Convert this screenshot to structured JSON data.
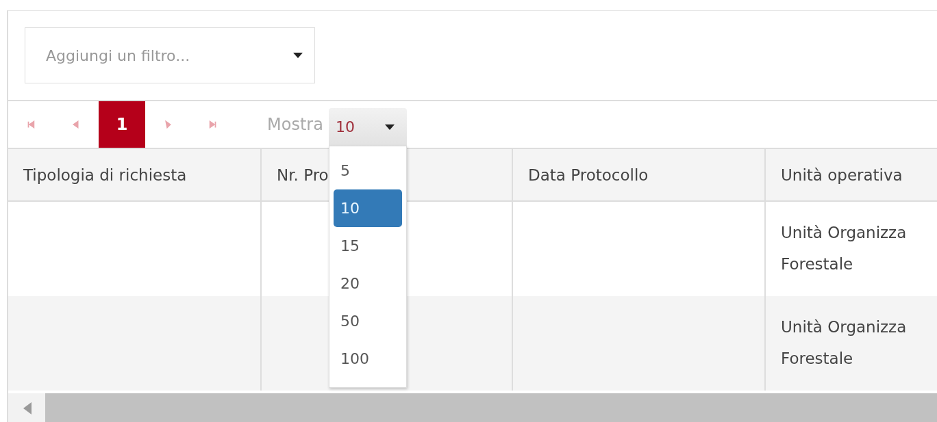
{
  "filter": {
    "placeholder": "Aggiungi un filtro..."
  },
  "pager": {
    "buttons": [
      {
        "kind": "first",
        "disabled": true
      },
      {
        "kind": "prev",
        "disabled": true
      },
      {
        "kind": "page",
        "label": "1",
        "selected": true
      },
      {
        "kind": "next",
        "disabled": true
      },
      {
        "kind": "last",
        "disabled": true
      }
    ],
    "show_label": "Mostra",
    "page_size": "10"
  },
  "page_size_options": [
    {
      "label": "5",
      "selected": false
    },
    {
      "label": "10",
      "selected": true
    },
    {
      "label": "15",
      "selected": false
    },
    {
      "label": "20",
      "selected": false
    },
    {
      "label": "50",
      "selected": false
    },
    {
      "label": "100",
      "selected": false
    }
  ],
  "table": {
    "columns": [
      "Tipologia di richiesta",
      "Nr. Pro",
      "Data Protocollo",
      "Unità operativa"
    ],
    "rows": [
      {
        "cells": [
          "",
          "",
          "",
          [
            "Unità Organizza",
            "Forestale"
          ]
        ]
      },
      {
        "cells": [
          "",
          "",
          "",
          [
            "Unità Organizza",
            "Forestale"
          ]
        ]
      }
    ]
  }
}
